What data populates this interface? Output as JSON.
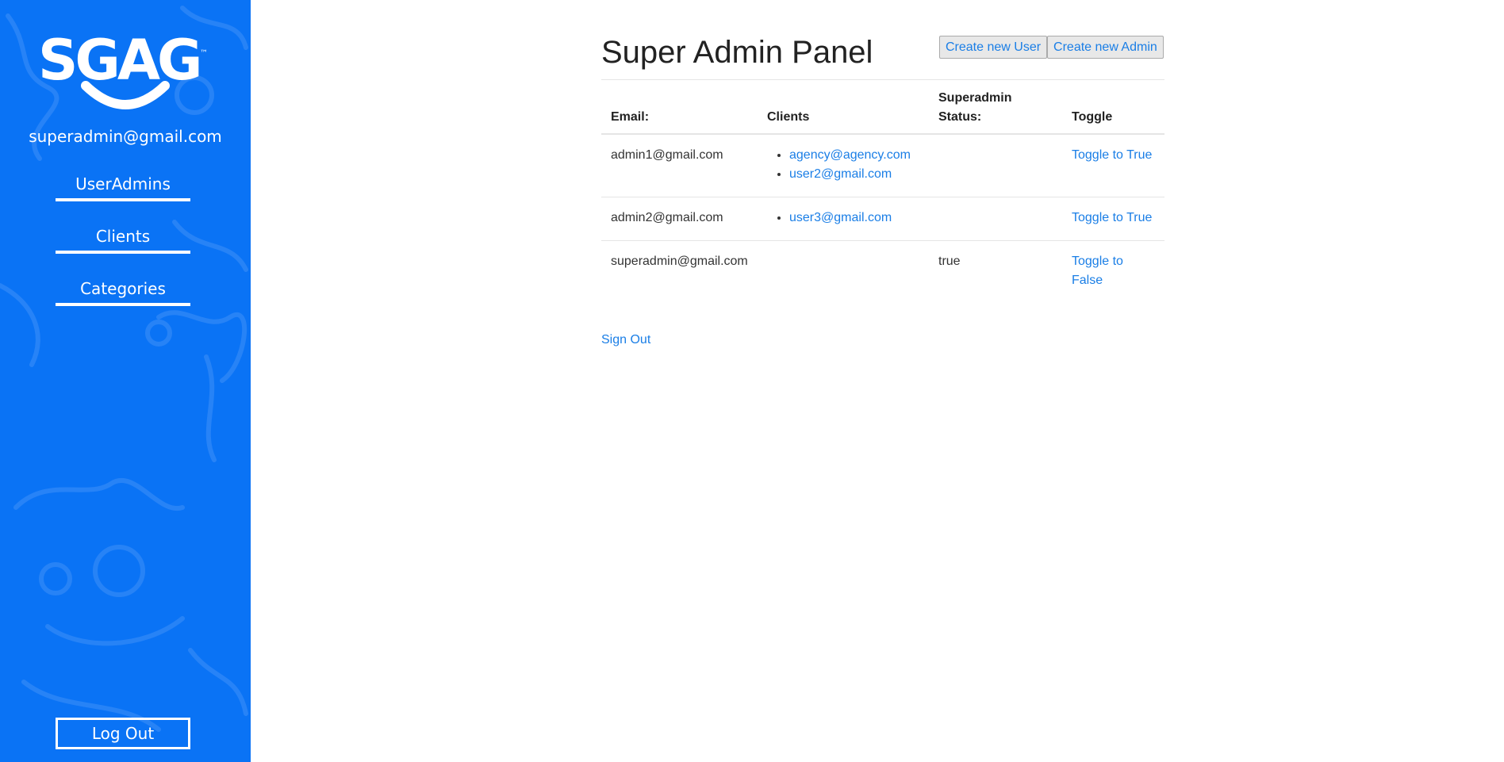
{
  "sidebar": {
    "brand": "SGAG",
    "user_email": "superadmin@gmail.com",
    "nav": [
      "UserAdmins",
      "Clients",
      "Categories"
    ],
    "logout_label": "Log Out",
    "colors": {
      "background": "#0a73f5",
      "text": "#ffffff"
    }
  },
  "main": {
    "title": "Super Admin Panel",
    "buttons": {
      "create_user": "Create new User",
      "create_admin": "Create new Admin"
    },
    "table": {
      "headers": {
        "email": "Email:",
        "clients": "Clients",
        "status": "Superadmin Status:",
        "toggle": "Toggle"
      },
      "rows": [
        {
          "email": "admin1@gmail.com",
          "clients": [
            "agency@agency.com",
            "user2@gmail.com"
          ],
          "status": "",
          "toggle": "Toggle to True"
        },
        {
          "email": "admin2@gmail.com",
          "clients": [
            "user3@gmail.com"
          ],
          "status": "",
          "toggle": "Toggle to True"
        },
        {
          "email": "superadmin@gmail.com",
          "clients": [],
          "status": "true",
          "toggle": "Toggle to False"
        }
      ]
    },
    "signout_label": "Sign Out",
    "colors": {
      "link": "#1a7ee6"
    }
  }
}
